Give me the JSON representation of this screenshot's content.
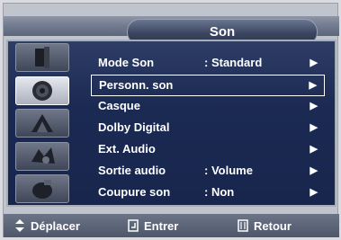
{
  "header": {
    "title": "Son"
  },
  "sidebar": {
    "icons": [
      {
        "name": "picture-icon",
        "active": false
      },
      {
        "name": "sound-icon",
        "active": true
      },
      {
        "name": "channel-icon",
        "active": false
      },
      {
        "name": "setup-icon",
        "active": false
      },
      {
        "name": "input-icon",
        "active": false
      }
    ]
  },
  "menu": {
    "items": [
      {
        "label": "Mode Son",
        "value": ": Standard",
        "arrow": "▶",
        "selected": false
      },
      {
        "label": "Personn. son",
        "value": "",
        "arrow": "▶",
        "selected": true
      },
      {
        "label": "Casque",
        "value": "",
        "arrow": "▶",
        "selected": false
      },
      {
        "label": "Dolby Digital",
        "value": "",
        "arrow": "▶",
        "selected": false
      },
      {
        "label": "Ext. Audio",
        "value": "",
        "arrow": "▶",
        "selected": false
      },
      {
        "label": "Sortie audio",
        "value": ": Volume",
        "arrow": "▶",
        "selected": false
      },
      {
        "label": "Coupure son",
        "value": ": Non",
        "arrow": "▶",
        "selected": false
      }
    ]
  },
  "footer": {
    "move_label": "Déplacer",
    "enter_label": "Entrer",
    "return_label": "Retour"
  }
}
